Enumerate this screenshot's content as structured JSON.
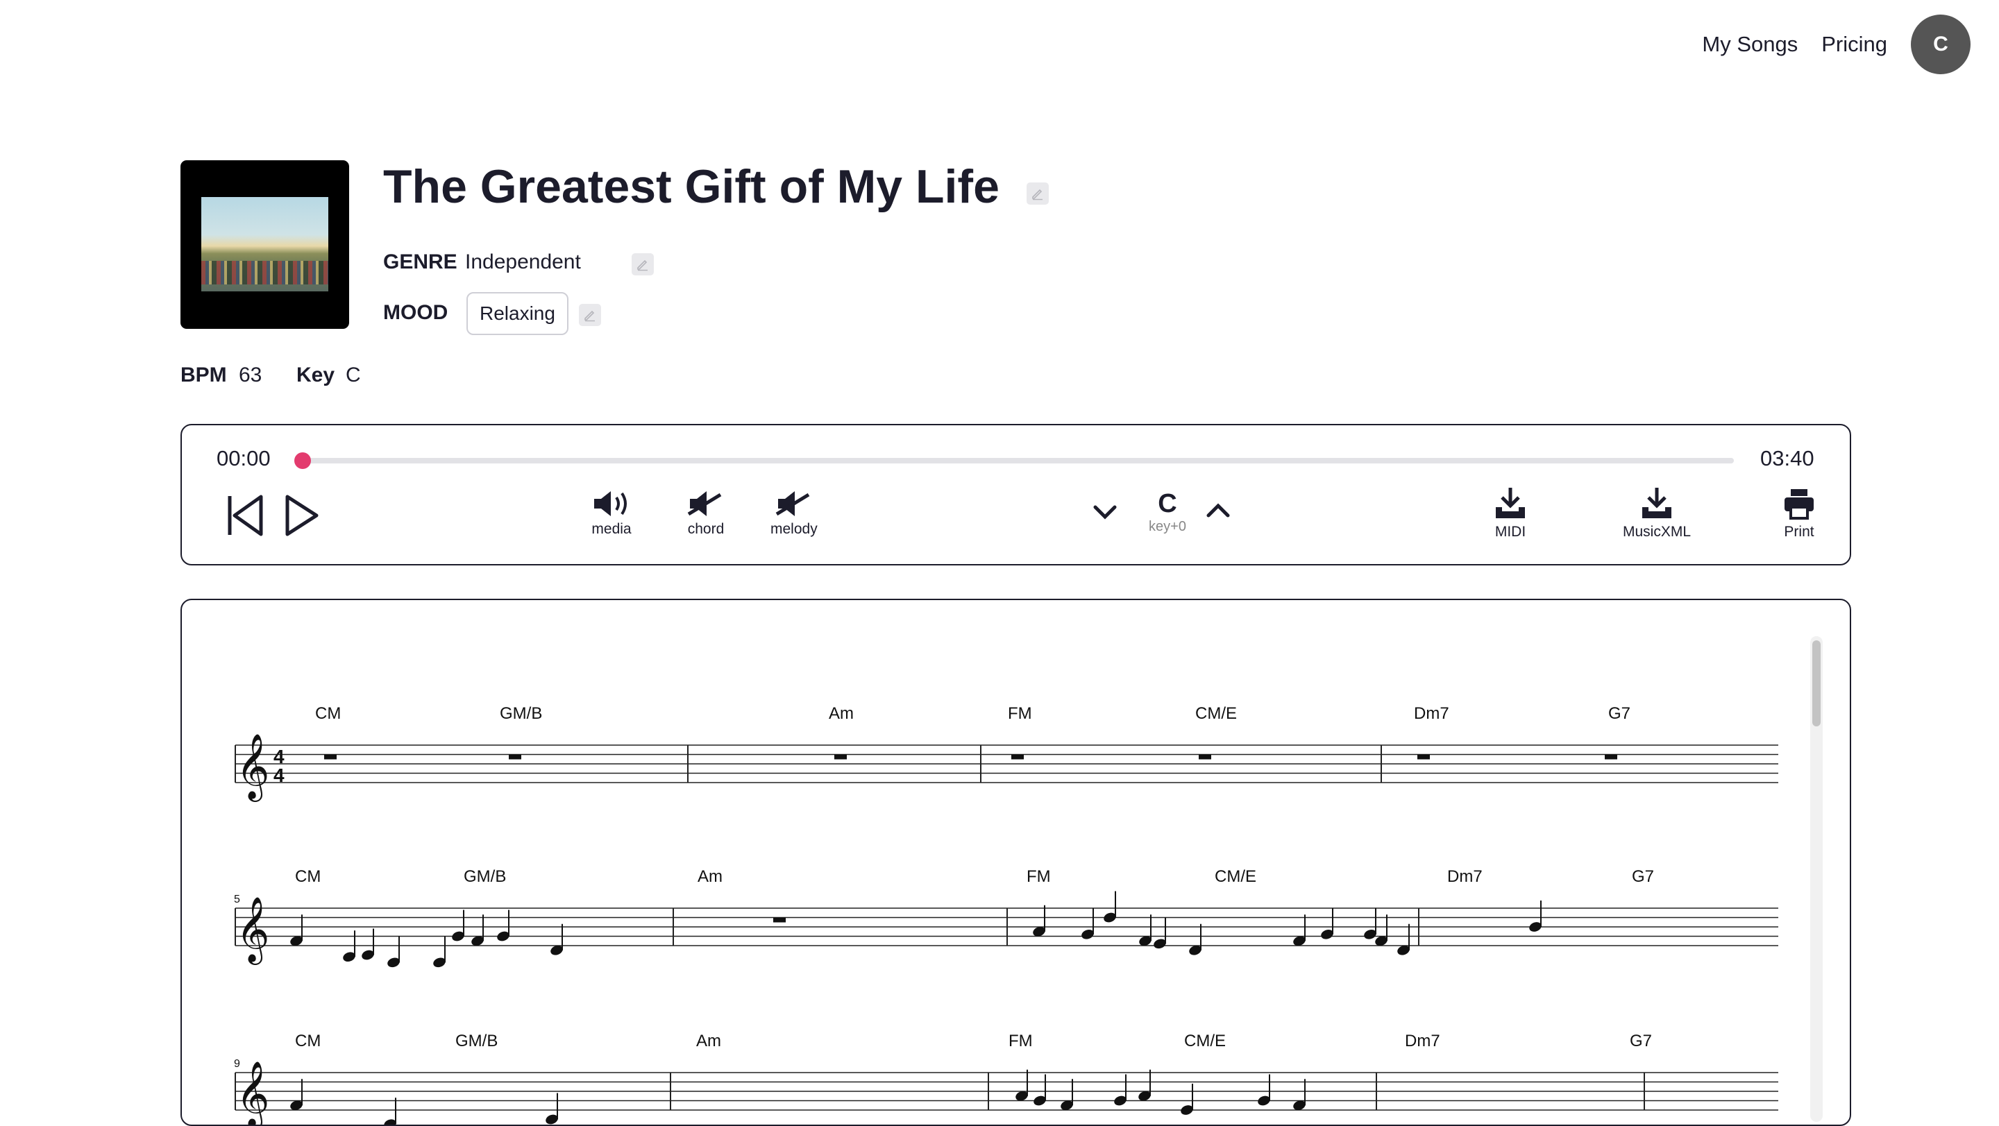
{
  "nav": {
    "my_songs": "My Songs",
    "pricing": "Pricing",
    "avatar_initial": "C"
  },
  "song": {
    "title": "The Greatest Gift of My Life",
    "genre_label": "GENRE",
    "genre": "Independent",
    "mood_label": "MOOD",
    "mood": "Relaxing",
    "bpm_label": "BPM",
    "bpm": "63",
    "key_label": "Key",
    "key": "C"
  },
  "player": {
    "current_time": "00:00",
    "total_time": "03:40",
    "progress": 0,
    "toggles": {
      "media": "media",
      "chord": "chord",
      "melody": "melody"
    },
    "key_value": "C",
    "key_offset": "key+0",
    "downloads": {
      "midi": "MIDI",
      "musicxml": "MusicXML",
      "print": "Print"
    }
  },
  "score": {
    "systems": [
      {
        "measure_number": "",
        "chords": [
          "CM",
          "GM/B",
          "Am",
          "FM",
          "CM/E",
          "Dm7",
          "G7"
        ]
      },
      {
        "measure_number": "5",
        "chords": [
          "CM",
          "GM/B",
          "Am",
          "FM",
          "CM/E",
          "Dm7",
          "G7"
        ]
      },
      {
        "measure_number": "9",
        "chords": [
          "CM",
          "GM/B",
          "Am",
          "FM",
          "CM/E",
          "Dm7",
          "G7"
        ]
      }
    ]
  }
}
